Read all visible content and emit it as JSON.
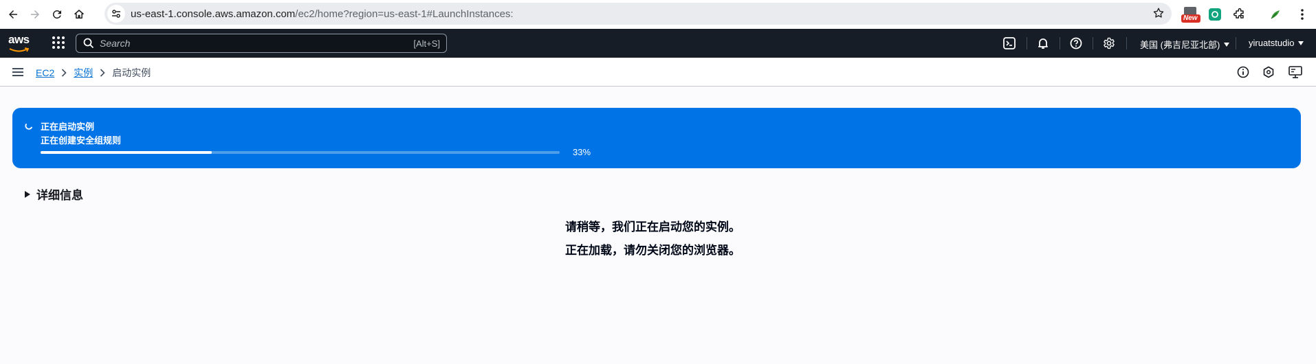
{
  "browser": {
    "url_host": "us-east-1.console.aws.amazon.com",
    "url_path": "/ec2/home?region=us-east-1#LaunchInstances:",
    "ext_badge": "New"
  },
  "aws_nav": {
    "logo_text": "aws",
    "search_placeholder": "Search",
    "search_shortcut": "[Alt+S]",
    "region_label": "美国 (弗吉尼亚北部)",
    "account_label": "yiruatstudio"
  },
  "breadcrumb": {
    "items": [
      "EC2",
      "实例"
    ],
    "current": "启动实例"
  },
  "flash": {
    "title": "正在启动实例",
    "subtitle": "正在创建安全组规则",
    "progress_percent": 33,
    "progress_label": "33%"
  },
  "details": {
    "label": "详细信息"
  },
  "messages": {
    "line1": "请稍等，我们正在启动您的实例。",
    "line2": "正在加载，请勿关闭您的浏览器。"
  },
  "colors": {
    "flash_bg": "#0073e6",
    "nav_bg": "#161d26",
    "link": "#0972d3"
  }
}
